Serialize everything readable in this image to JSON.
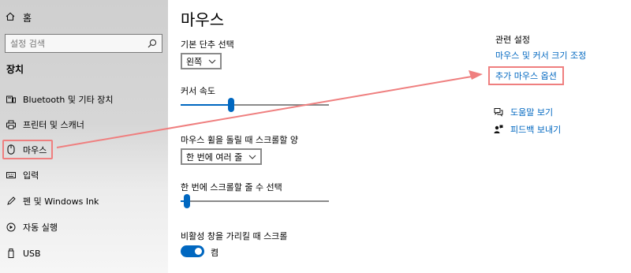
{
  "sidebar": {
    "home_label": "홈",
    "search_placeholder": "설정 검색",
    "section_title": "장치",
    "items": [
      {
        "label": "Bluetooth 및 기타 장치",
        "icon": "bluetooth-devices-icon"
      },
      {
        "label": "프린터 및 스캐너",
        "icon": "printer-icon"
      },
      {
        "label": "마우스",
        "icon": "mouse-icon"
      },
      {
        "label": "입력",
        "icon": "keyboard-icon"
      },
      {
        "label": "펜 및 Windows Ink",
        "icon": "pen-icon"
      },
      {
        "label": "자동 실행",
        "icon": "autoplay-icon"
      },
      {
        "label": "USB",
        "icon": "usb-icon"
      }
    ]
  },
  "main": {
    "title": "마우스",
    "primary_button_label": "기본 단추 선택",
    "primary_button_value": "왼쪽",
    "cursor_speed_label": "커서 속도",
    "cursor_speed_level": 0.32,
    "scroll_label": "마우스 휠을 돌릴 때 스크롤할 양",
    "scroll_value": "한 번에 여러 줄",
    "lines_label": "한 번에 스크롤할 줄 수 선택",
    "lines_level": 0.02,
    "inactive_scroll_label": "비활성 창을 가리킬 때 스크롤",
    "toggle_state": "켬"
  },
  "related": {
    "title": "관련 설정",
    "link_cursor_size": "마우스 및 커서 크기 조정",
    "link_extra_options": "추가 마우스 옵션",
    "help_label": "도움말 보기",
    "feedback_label": "피드백 보내기"
  },
  "colors": {
    "accent": "#0067c0",
    "highlight": "#ef7f7f"
  }
}
